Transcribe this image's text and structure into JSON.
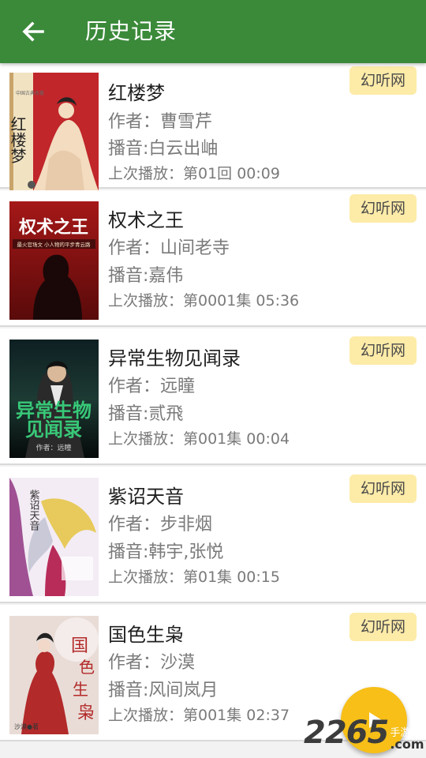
{
  "appbar": {
    "title": "历史记录",
    "back_icon": "arrow-left-icon"
  },
  "books": [
    {
      "title": "红楼梦",
      "author": "作者：曹雪芹",
      "narrator": "播音:白云出岫",
      "last_play": "上次播放：第01回 00:09",
      "source": "幻听网",
      "cover_title": "红楼梦",
      "cover_bg": "#f1e3c2",
      "cover_accent": "#b41f1f"
    },
    {
      "title": "权术之王",
      "author": "作者：山间老寺",
      "narrator": "播音:嘉伟",
      "last_play": "上次播放：第0001集 05:36",
      "source": "幻听网",
      "cover_title": "权术之王",
      "cover_subtitle": "最火官场文 小人物的平步青云路",
      "cover_bg": "#8e1414",
      "cover_accent": "#ffffff"
    },
    {
      "title": "异常生物见闻录",
      "author": "作者：远瞳",
      "narrator": "播音:贰飛",
      "last_play": "上次播放：第001集 00:04",
      "source": "幻听网",
      "cover_title": "异常生物见闻录",
      "cover_author": "作者：远瞳",
      "cover_bg": "#15302a",
      "cover_accent": "#36c47a"
    },
    {
      "title": "紫诏天音",
      "author": "作者：步非烟",
      "narrator": "播音:韩宇,张悦",
      "last_play": "上次播放：第01集 00:15",
      "source": "幻听网",
      "cover_title": "紫诏天音",
      "cover_bg": "#f3ecf4",
      "cover_accent": "#8a2a7a"
    },
    {
      "title": "国色生枭",
      "author": "作者：沙漠",
      "narrator": "播音:风间岚月",
      "last_play": "上次播放：第001集 02:37",
      "source": "幻听网",
      "cover_title": "国色生枭",
      "cover_author": "沙漠●著",
      "cover_bg": "#e9dcd6",
      "cover_accent": "#b22a2a"
    }
  ],
  "fab": {
    "icon": "play-icon",
    "color": "#f7bf17"
  },
  "watermark": {
    "number": "2265",
    "site_cn": "手游网",
    "site_domain": ".com"
  },
  "colors": {
    "primary": "#3b8a3a",
    "badge_bg": "#fdeba8",
    "background": "#f2f2f2"
  }
}
